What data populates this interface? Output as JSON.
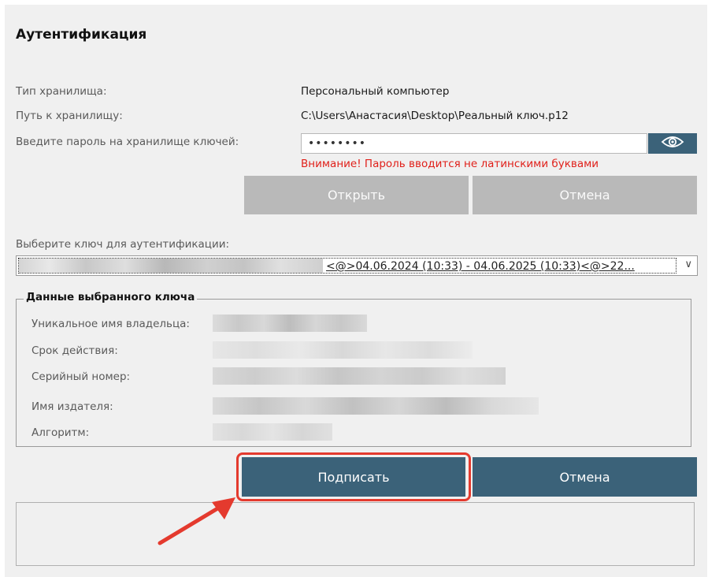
{
  "dialog": {
    "title": "Аутентификация"
  },
  "storage": {
    "type_label": "Тип хранилища:",
    "type_value": "Персональный компьютер",
    "path_label": "Путь к хранилищу:",
    "path_value": "C:\\Users\\Анастасия\\Desktop\\Реальный ключ.p12",
    "password_label": "Введите пароль на хранилище ключей:",
    "password_value": "••••••••",
    "warning": "Внимание! Пароль вводится не латинскими буквами",
    "open_button": "Открыть",
    "cancel_button": "Отмена"
  },
  "key_select": {
    "label": "Выберите ключ для аутентификации:",
    "selected_value": "<@>04.06.2024 (10:33) - 04.06.2025 (10:33)<@>22...",
    "chevron": "∨"
  },
  "key_details": {
    "legend": "Данные выбранного ключа",
    "owner_label": "Уникальное имя владельца:",
    "validity_label": "Срок действия:",
    "serial_label": "Серийный номер:",
    "issuer_label": "Имя издателя:",
    "algorithm_label": "Алгоритм:"
  },
  "actions": {
    "sign_button": "Подписать",
    "cancel_button": "Отмена"
  },
  "colors": {
    "accent": "#3b6279",
    "warning": "#e0201a",
    "highlight": "#e43a2e",
    "disabled_button": "#b9b9b9"
  },
  "icons": {
    "password_toggle": "eye-icon",
    "dropdown": "chevron-down-icon",
    "annotation": "arrow-icon"
  }
}
